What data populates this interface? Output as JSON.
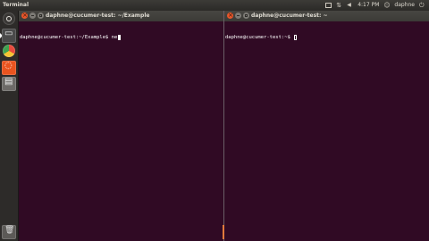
{
  "top_panel": {
    "app_name": "Terminal",
    "clock": "4:17 PM",
    "user": "daphne",
    "indicator_icons": [
      "mail-icon",
      "network-icon",
      "volume-icon",
      "user-icon",
      "power-icon"
    ]
  },
  "launcher": {
    "items": [
      "dash-icon",
      "terminal-icon",
      "chrome-icon",
      "ubuntu-one-icon",
      "files-icon"
    ],
    "trash": "trash-icon"
  },
  "left_terminal": {
    "title": "daphne@cucumer-test: ~/Example",
    "prompt": "daphne@cucumer-test:~/Example$ ",
    "input": "ne"
  },
  "right_terminal": {
    "title": "daphne@cucumer-test: ~",
    "prompt": "daphne@cucumer-test:~$ ",
    "input": ""
  },
  "colors": {
    "terminal_bg": "#300a24",
    "panel_bg": "#3c3b37",
    "close_button": "#e8562a"
  }
}
